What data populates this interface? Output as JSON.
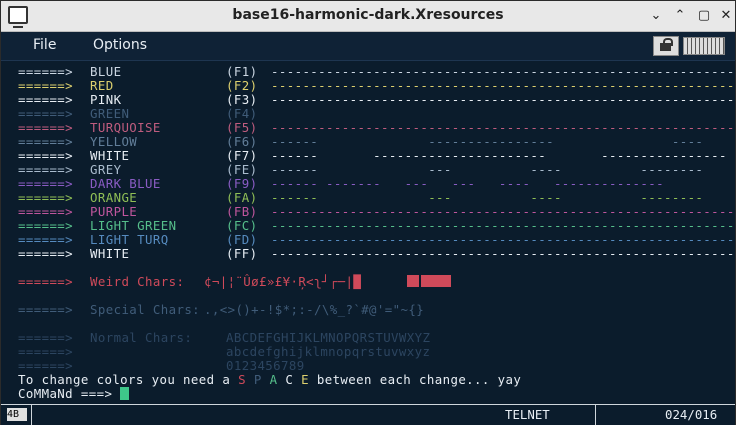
{
  "window": {
    "title": "base16-harmonic-dark.Xresources",
    "minimize_glyph": "⌄",
    "maximize_glyph": "⌃",
    "restore_glyph": "▢",
    "close_glyph": "✕"
  },
  "menu": {
    "file": "File",
    "options": "Options"
  },
  "colors": {
    "blue": "#cbd6e2",
    "red": "#ddd06e",
    "pink": "#e8eef4",
    "green": "#405c79",
    "turq": "#bf5c7e",
    "yellow": "#627e99",
    "white": "#e8eef4",
    "grey": "#aabcce",
    "darkblue": "#8a5cc4",
    "orange": "#90bf56",
    "purple": "#bf569d",
    "lightgreen": "#56bf8b",
    "lightturq": "#568bbf",
    "weird": "#d04a5a",
    "special": "#405c79",
    "normal": "#2c4560",
    "text": "#e8eef4",
    "space_s": "#d04a5a",
    "space_p": "#405c79",
    "space_a": "#56bf8b",
    "space_c": "#e8eef4",
    "space_e": "#ddd06e",
    "cursor": "#3ec78a",
    "bg": "#0b1c2c"
  },
  "rows": [
    {
      "arrow": "======>",
      "name": "BLUE",
      "key": "(F1)",
      "dashes": "-----------------------------------------------------------"
    },
    {
      "arrow": "======>",
      "name": "RED",
      "key": "(F2)",
      "dashes": "-----------------------------------------------------------"
    },
    {
      "arrow": "======>",
      "name": "PINK",
      "key": "(F3)",
      "dashes": "-----------------------------------------------------------"
    },
    {
      "arrow": "======>",
      "name": "GREEN",
      "key": "(F4)",
      "dashes": ""
    },
    {
      "arrow": "======>",
      "name": "TURQUOISE",
      "key": "(F5)",
      "dashes": "-----------------------------------------------------------"
    },
    {
      "arrow": "======>",
      "name": "YELLOW",
      "key": "(F6)",
      "dashes": "------              ----------------               ----"
    },
    {
      "arrow": "======>",
      "name": "WHITE",
      "key": "(F7)",
      "dashes": "------       ----------------------       ----------------"
    },
    {
      "arrow": "======>",
      "name": "GREY",
      "key": "(FE)",
      "dashes": "------              ---          ----          --------"
    },
    {
      "arrow": "======>",
      "name": "DARK BLUE",
      "key": "(F9)",
      "dashes": "------ -------   ---   ---   ----   --------------"
    },
    {
      "arrow": "======>",
      "name": "ORANGE",
      "key": "(FA)",
      "dashes": "------              ---          ----          --------"
    },
    {
      "arrow": "======>",
      "name": "PURPLE",
      "key": "(FB)",
      "dashes": "-----------------------------------------------------------"
    },
    {
      "arrow": "======>",
      "name": "LIGHT GREEN",
      "key": "(FC)",
      "dashes": "-----------------------------------------------------------"
    },
    {
      "arrow": "======>",
      "name": "LIGHT TURQ",
      "key": "(FD)",
      "dashes": "-----------------------------------------------------------"
    },
    {
      "arrow": "======>",
      "name": "WHITE",
      "key": "(FF)",
      "dashes": "-----------------------------------------------------------"
    }
  ],
  "weird": {
    "arrow": "======>",
    "label": "Weird Chars:",
    "chars": "¢¬|¦¨Ûø£»£¥·Ŗ<ʅ┘┌─|█"
  },
  "special": {
    "arrow": "======>",
    "label": "Special Chars:",
    "chars": ".,<>()+-!$*;:-/\\%_?`#@'=\"~{}"
  },
  "normal": {
    "arrow": "======>",
    "label": "Normal Chars:",
    "upper": "ABCDEFGHIJKLMNOPQRSTUVWXYZ",
    "lower": "abcdefghijklmnopqrstuvwxyz",
    "digits": "0123456789"
  },
  "instruction": {
    "before": "To change colors you need a",
    "s": "S",
    "p": "P",
    "a": "A",
    "c": "C",
    "e": "E",
    "after": "between each change... yay"
  },
  "prompt": "CoMMaNd ===>",
  "status": {
    "icon_text": "4B",
    "telnet": "TELNET",
    "position": "024/016"
  }
}
